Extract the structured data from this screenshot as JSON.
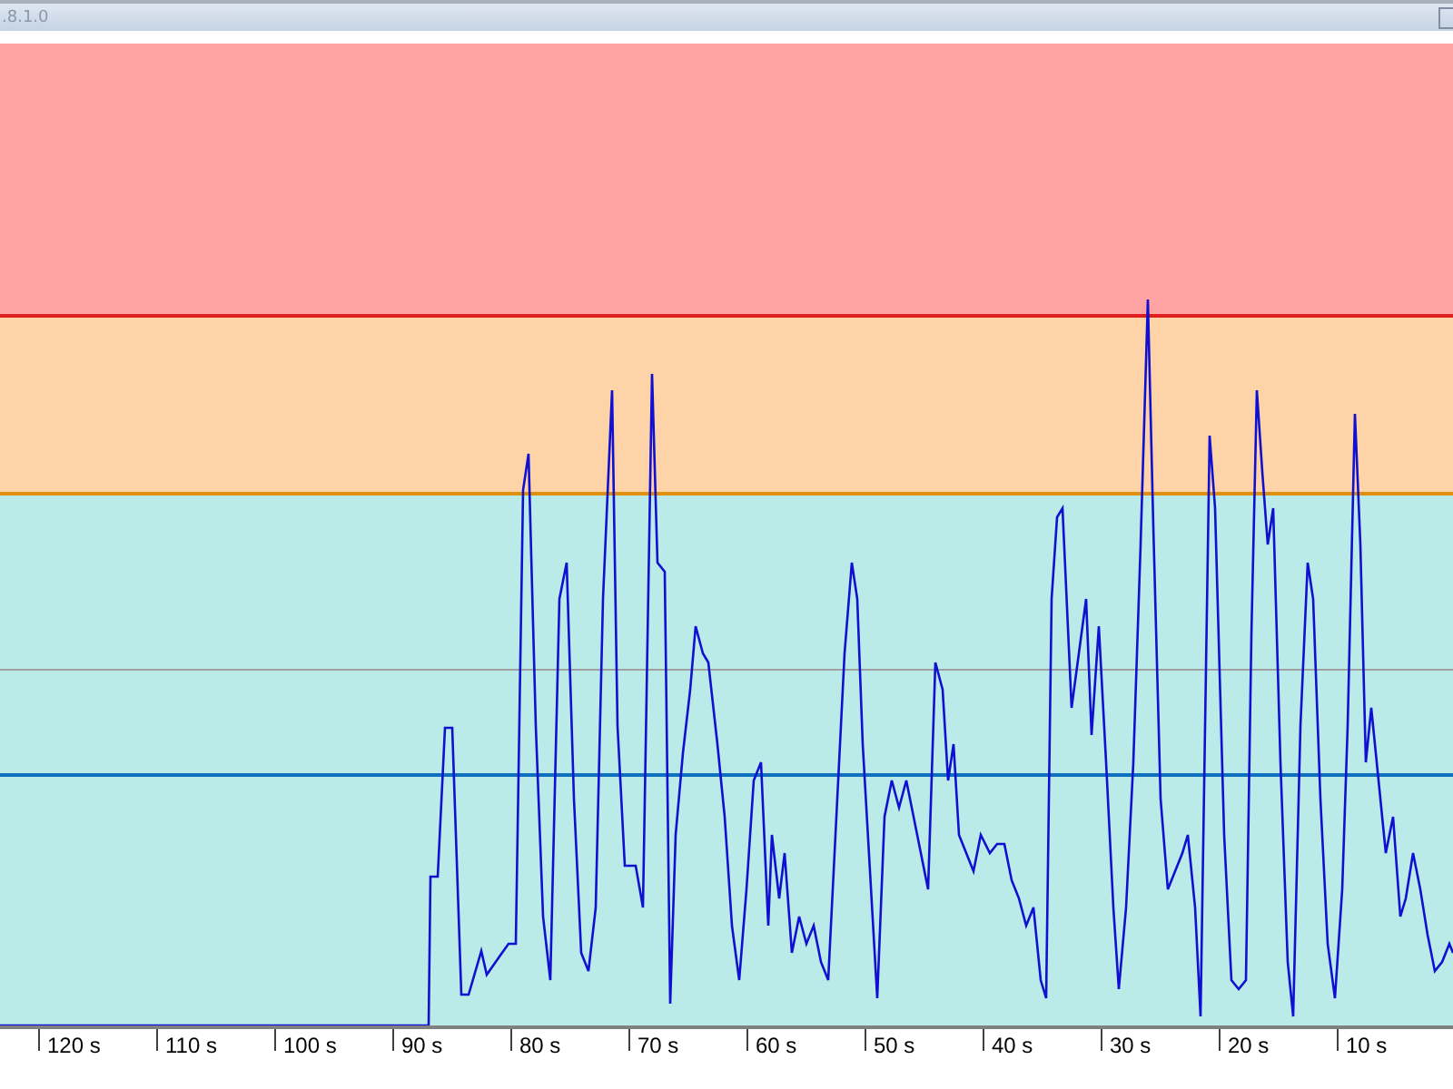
{
  "title_bar": {
    "title": ".8.1.0"
  },
  "zones": [
    {
      "color": "#ffa3a3"
    },
    {
      "color": "#ffd3a8"
    },
    {
      "color": "#bbebe8"
    }
  ],
  "time_axis": {
    "ticks": [
      "120 s",
      "110 s",
      "100 s",
      "90 s",
      "80 s",
      "70 s",
      "60 s",
      "50 s",
      "40 s",
      "30 s",
      "20 s",
      "10 s"
    ]
  }
}
